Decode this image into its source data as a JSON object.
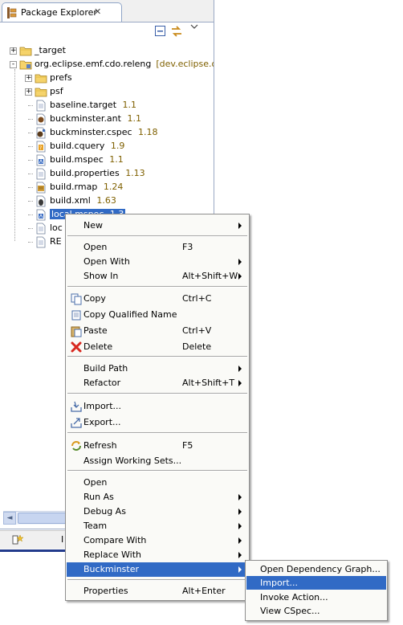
{
  "view": {
    "tab_label": "Package Explorer",
    "tab_close": "✕"
  },
  "tree": {
    "items": [
      {
        "label": "_target",
        "expander": "+",
        "icon": "folder-icon"
      },
      {
        "label": "org.eclipse.emf.cdo.releng",
        "decoration": "[dev.eclipse.o",
        "expander": "-",
        "icon": "project-icon"
      },
      {
        "label": "prefs",
        "expander": "+",
        "icon": "folder-icon"
      },
      {
        "label": "psf",
        "expander": "+",
        "icon": "folder-icon"
      },
      {
        "label": "baseline.target",
        "revision": "1.1",
        "icon": "file-icon"
      },
      {
        "label": "buckminster.ant",
        "revision": "1.1",
        "icon": "buckminster-icon"
      },
      {
        "label": "buckminster.cspec",
        "revision": "1.18",
        "icon": "cspec-icon"
      },
      {
        "label": "build.cquery",
        "revision": "1.9",
        "icon": "cquery-icon"
      },
      {
        "label": "build.mspec",
        "revision": "1.1",
        "icon": "mspec-icon"
      },
      {
        "label": "build.properties",
        "revision": "1.13",
        "icon": "file-icon"
      },
      {
        "label": "build.rmap",
        "revision": "1.24",
        "icon": "rmap-icon"
      },
      {
        "label": "build.xml",
        "revision": "1.63",
        "icon": "ant-icon"
      },
      {
        "label": "local.mspec",
        "revision": "1.3",
        "icon": "mspec-icon",
        "selected": true
      },
      {
        "label": "loc",
        "icon": "file-icon"
      },
      {
        "label": "RE",
        "icon": "file-icon"
      }
    ]
  },
  "bottom": {
    "text": "I"
  },
  "context_menu": {
    "items": [
      {
        "label": "New",
        "submenu": true
      },
      {
        "label": "Open",
        "accel": "F3"
      },
      {
        "label": "Open With",
        "submenu": true
      },
      {
        "label": "Show In",
        "accel": "Alt+Shift+W",
        "submenu": true
      },
      {
        "label": "Copy",
        "accel": "Ctrl+C",
        "icon": "copy-icon"
      },
      {
        "label": "Copy Qualified Name",
        "icon": "copy-qualified-icon"
      },
      {
        "label": "Paste",
        "accel": "Ctrl+V",
        "icon": "paste-icon"
      },
      {
        "label": "Delete",
        "accel": "Delete",
        "icon": "delete-icon"
      },
      {
        "label": "Build Path",
        "submenu": true
      },
      {
        "label": "Refactor",
        "accel": "Alt+Shift+T",
        "submenu": true
      },
      {
        "label": "Import...",
        "icon": "import-icon"
      },
      {
        "label": "Export...",
        "icon": "export-icon"
      },
      {
        "label": "Refresh",
        "accel": "F5",
        "icon": "refresh-icon"
      },
      {
        "label": "Assign Working Sets..."
      },
      {
        "label": "Open"
      },
      {
        "label": "Run As",
        "submenu": true
      },
      {
        "label": "Debug As",
        "submenu": true
      },
      {
        "label": "Team",
        "submenu": true
      },
      {
        "label": "Compare With",
        "submenu": true
      },
      {
        "label": "Replace With",
        "submenu": true
      },
      {
        "label": "Buckminster",
        "submenu": true,
        "highlighted": true
      },
      {
        "label": "Properties",
        "accel": "Alt+Enter"
      }
    ]
  },
  "submenu": {
    "items": [
      {
        "label": "Open Dependency Graph..."
      },
      {
        "label": "Import...",
        "highlighted": true
      },
      {
        "label": "Invoke Action..."
      },
      {
        "label": "View CSpec..."
      }
    ]
  },
  "colors": {
    "selection": "#316ac5",
    "revision_text": "#7f6000",
    "frame_border": "#9aa9c4"
  }
}
